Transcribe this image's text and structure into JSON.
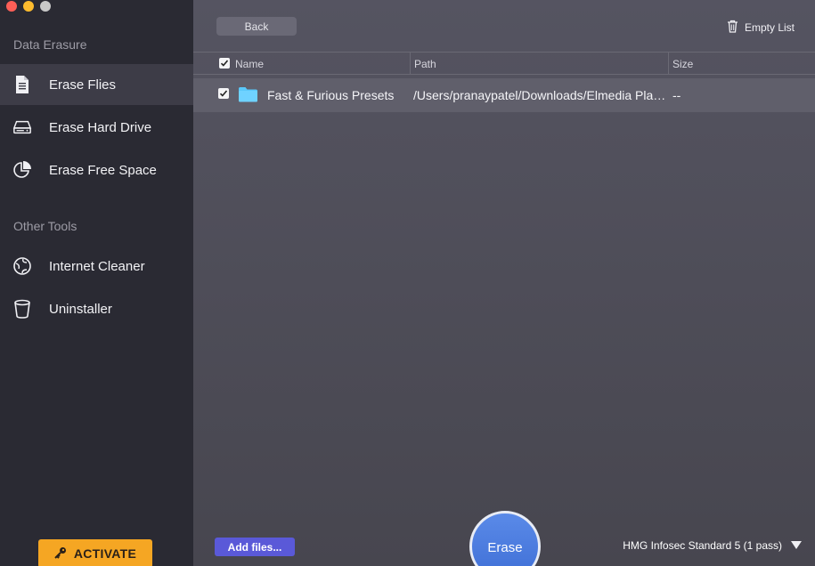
{
  "colors": {
    "close": "#ff5f57",
    "minimize": "#febc2e",
    "zoom": "#c8c8c8",
    "accent": "#5a59d8",
    "activate": "#f5a623",
    "folder": "#5ac8fa"
  },
  "sidebar": {
    "section_data_erasure": "Data Erasure",
    "section_other_tools": "Other Tools",
    "items": [
      {
        "label": "Erase Flies",
        "icon": "document-icon",
        "active": true
      },
      {
        "label": "Erase Hard Drive",
        "icon": "hard-drive-icon",
        "active": false
      },
      {
        "label": "Erase Free Space",
        "icon": "pie-chart-icon",
        "active": false
      },
      {
        "label": "Internet Cleaner",
        "icon": "globe-icon",
        "active": false
      },
      {
        "label": "Uninstaller",
        "icon": "trash-can-icon",
        "active": false
      }
    ],
    "activate_label": "ACTIVATE"
  },
  "toolbar": {
    "back_label": "Back",
    "empty_list_label": "Empty List"
  },
  "table": {
    "columns": [
      "Name",
      "Path",
      "Size"
    ],
    "rows": [
      {
        "checked": true,
        "name": "Fast & Furious Presets",
        "path": "/Users/pranaypatel/Downloads/Elmedia Player",
        "size": "--"
      }
    ]
  },
  "footer": {
    "add_files_label": "Add files...",
    "erase_label": "Erase",
    "method_label": "HMG Infosec Standard 5 (1 pass)"
  }
}
